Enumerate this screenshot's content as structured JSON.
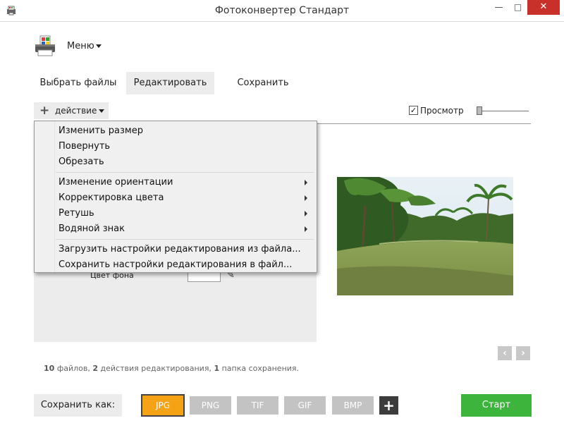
{
  "window": {
    "title": "Фотоконвертер Стандарт",
    "controls": {
      "minimize": "—",
      "maximize": "□",
      "close": "✕"
    }
  },
  "menu": {
    "label": "Меню"
  },
  "tabs": [
    {
      "label": "Выбрать файлы",
      "active": false
    },
    {
      "label": "Редактировать",
      "active": true
    },
    {
      "label": "Сохранить",
      "active": false
    }
  ],
  "toolbar": {
    "action_label": "действие",
    "preview_label": "Просмотр",
    "preview_checked": true
  },
  "dropdown": {
    "items": [
      {
        "label": "Изменить размер",
        "submenu": false
      },
      {
        "label": "Повернуть",
        "submenu": false
      },
      {
        "label": "Обрезать",
        "submenu": false
      },
      {
        "label": "Изменение ориентации",
        "submenu": true
      },
      {
        "label": "Корректировка цвета",
        "submenu": true
      },
      {
        "label": "Ретушь",
        "submenu": true
      },
      {
        "label": "Водяной знак",
        "submenu": true
      },
      {
        "label": "Загрузить настройки редактирования из файла...",
        "submenu": false
      },
      {
        "label": "Сохранить настройки редактирования в файл...",
        "submenu": false
      }
    ]
  },
  "panel": {
    "background_color_label": "Цвет фона",
    "background_color": "#ffffff"
  },
  "status": {
    "files_count": "10",
    "files_text": "файлов,",
    "actions_count": "2",
    "actions_text": "действия редактирования,",
    "folders_count": "1",
    "folders_text": "папка сохранения."
  },
  "bottom": {
    "save_as_label": "Сохранить как:",
    "formats": [
      {
        "label": "JPG",
        "active": true
      },
      {
        "label": "PNG",
        "active": false
      },
      {
        "label": "TIF",
        "active": false
      },
      {
        "label": "GIF",
        "active": false
      },
      {
        "label": "BMP",
        "active": false
      }
    ],
    "add_format": "+",
    "start_label": "Старт"
  },
  "colors": {
    "accent": "#f5a214",
    "start": "#3db53d",
    "close": "#c7312a",
    "panel": "#ececec"
  }
}
